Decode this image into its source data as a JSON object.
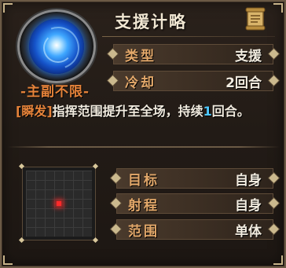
{
  "skill": {
    "name": "支援计略",
    "tag": "-主副不限-",
    "stats": [
      {
        "label": "类型",
        "value": "支援"
      },
      {
        "label": "冷却",
        "value": "2回合"
      }
    ]
  },
  "description": {
    "keyword": "[瞬发]",
    "text_before": "指挥范围提升至全场，持续",
    "number": "1",
    "text_after": "回合。"
  },
  "range": {
    "stats": [
      {
        "label": "目标",
        "value": "自身"
      },
      {
        "label": "射程",
        "value": "自身"
      },
      {
        "label": "范围",
        "value": "单体"
      }
    ]
  },
  "colors": {
    "tag": "#e6833a",
    "label": "#e3a86a",
    "keyword": "#e6833a",
    "number": "#4fc9ff",
    "grid_marker": "#ff2a2a"
  },
  "icons": [
    "skill-orb-icon",
    "scroll-icon",
    "grid-center-marker"
  ]
}
